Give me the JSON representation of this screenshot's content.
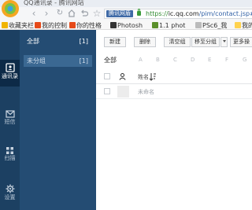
{
  "browser": {
    "tab_title": "QQ通讯录 - 腾讯网站",
    "url": {
      "secure_label": "腾讯网盾",
      "scheme": "https://",
      "host": "ic.qq.com",
      "path": "/pim/contact.jsp#"
    },
    "bookmarks": [
      {
        "label": "收藏夹栏",
        "color": "#f0b400"
      },
      {
        "label": "我的控制",
        "color": "#e64a19"
      },
      {
        "label": "你的性格",
        "color": "#e64a19"
      },
      {
        "label": "Photosh",
        "color": "#333333"
      },
      {
        "label": "1.1 phot",
        "color": "#5b8f2a"
      },
      {
        "label": "PSc6_我",
        "color": "#bbbbbb"
      },
      {
        "label": "我的",
        "color": "#ffd24d"
      }
    ]
  },
  "left_nav": {
    "items": [
      {
        "label": "通讯录",
        "icon": "contacts-icon",
        "active": true
      },
      {
        "label": "短信",
        "icon": "message-icon",
        "active": false
      },
      {
        "label": "扫描",
        "icon": "grid-icon",
        "active": false
      },
      {
        "label": "设置",
        "icon": "gear-icon",
        "active": false
      }
    ]
  },
  "groups": {
    "all_label": "全部",
    "all_count": "[1]",
    "ungrouped_label": "未分组",
    "ungrouped_count": "[1]"
  },
  "toolbar": {
    "new_label": "新建",
    "delete_label": "删除",
    "clear_group_label": "清空组",
    "move_group_label": "移至分组",
    "more_label": "更多操"
  },
  "alpha_filter": {
    "all_label": "全部",
    "letters": [
      "A",
      "B",
      "C",
      "D",
      "E",
      "F",
      "G"
    ]
  },
  "table": {
    "name_header": "姓名",
    "rows": [
      {
        "name": "未命名"
      }
    ]
  }
}
